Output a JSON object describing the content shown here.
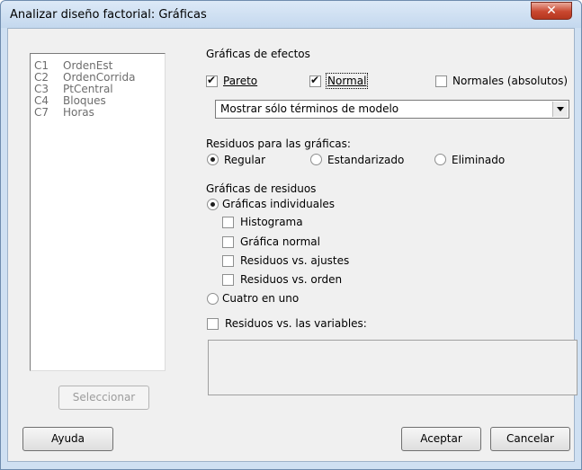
{
  "window": {
    "title": "Analizar diseño factorial: Gráficas",
    "close_glyph": "✕"
  },
  "variables": [
    {
      "col": "C1",
      "name": "OrdenEst"
    },
    {
      "col": "C2",
      "name": "OrdenCorrida"
    },
    {
      "col": "C3",
      "name": "PtCentral"
    },
    {
      "col": "C4",
      "name": "Bloques"
    },
    {
      "col": "C7",
      "name": "Horas"
    }
  ],
  "buttons": {
    "select": "Seleccionar",
    "help": "Ayuda",
    "ok": "Aceptar",
    "cancel": "Cancelar"
  },
  "effects": {
    "heading": "Gráficas de efectos",
    "pareto": {
      "label": "Pareto",
      "checked": true
    },
    "normal": {
      "label": "Normal",
      "checked": true
    },
    "half_normal": {
      "label": "Normales (absolutos)",
      "checked": false
    },
    "terms_select": "Mostrar sólo términos de modelo"
  },
  "residuals_for_plots": {
    "heading": "Residuos para las gráficas:",
    "options": [
      "Regular",
      "Estandarizado",
      "Eliminado"
    ],
    "selected": "Regular"
  },
  "residual_plots": {
    "heading": "Gráficas de residuos",
    "individual": "Gráficas individuales",
    "histogram": "Histograma",
    "normal_plot": "Gráfica normal",
    "vs_fits": "Residuos vs. ajustes",
    "vs_order": "Residuos vs. orden",
    "four_in_one": "Cuatro en uno",
    "selected": "Gráficas individuales",
    "vs_variables": "Residuos vs. las variables:"
  }
}
